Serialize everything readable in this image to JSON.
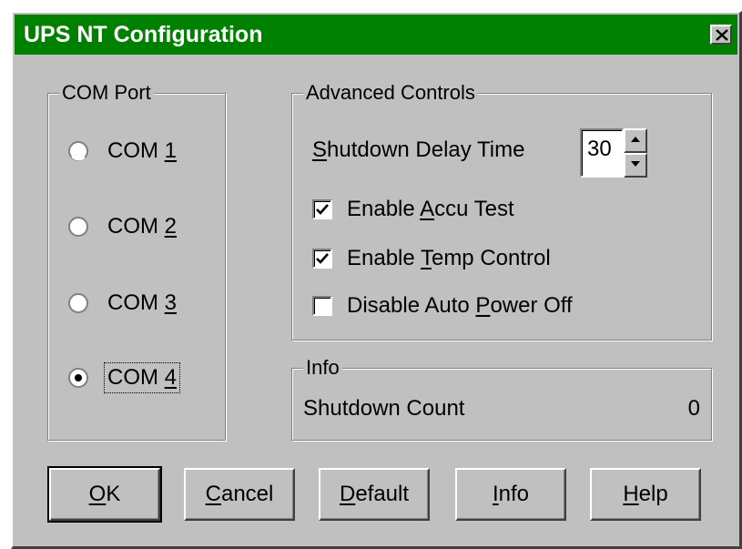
{
  "window": {
    "title": "UPS NT Configuration",
    "title_bar_color": "#008000"
  },
  "com_port": {
    "legend": "COM Port",
    "options": [
      {
        "label_prefix": "COM ",
        "label_key": "1",
        "selected": false
      },
      {
        "label_prefix": "COM ",
        "label_key": "2",
        "selected": false
      },
      {
        "label_prefix": "COM ",
        "label_key": "3",
        "selected": false
      },
      {
        "label_prefix": "COM ",
        "label_key": "4",
        "selected": true
      }
    ]
  },
  "advanced": {
    "legend": "Advanced Controls",
    "shutdown_delay": {
      "label_key": "S",
      "label_rest": "hutdown Delay Time",
      "value": "30"
    },
    "accu_test": {
      "pre": "Enable ",
      "key": "A",
      "post": "ccu Test",
      "checked": true
    },
    "temp_control": {
      "pre": "Enable ",
      "key": "T",
      "post": "emp Control",
      "checked": true
    },
    "auto_power_off": {
      "pre": "Disable Auto ",
      "key": "P",
      "post": "ower Off",
      "checked": false
    }
  },
  "info": {
    "legend": "Info",
    "shutdown_count_label": "Shutdown Count",
    "shutdown_count_value": "0"
  },
  "buttons": {
    "ok": {
      "key": "O",
      "rest": "K"
    },
    "cancel": {
      "key": "C",
      "rest": "ancel"
    },
    "default": {
      "key": "D",
      "rest": "efault"
    },
    "info": {
      "key": "I",
      "rest": "nfo"
    },
    "help": {
      "key": "H",
      "rest": "elp"
    }
  }
}
